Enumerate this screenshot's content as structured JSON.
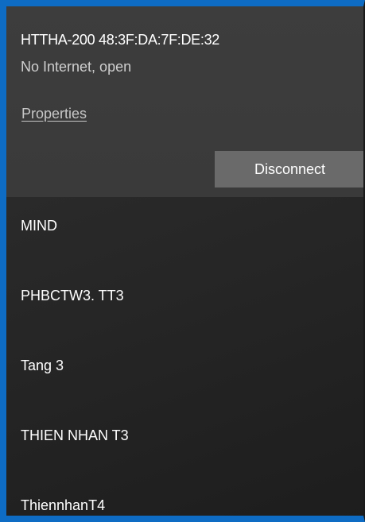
{
  "connected_network": {
    "name": "HTTHA-200 48:3F:DA:7F:DE:32",
    "status": "No Internet, open",
    "properties_label": "Properties",
    "disconnect_label": "Disconnect"
  },
  "networks": [
    {
      "name": "MIND"
    },
    {
      "name": "PHBCTW3. TT3"
    },
    {
      "name": "Tang 3"
    },
    {
      "name": "THIEN NHAN T3"
    },
    {
      "name": "ThiennhanT4"
    }
  ],
  "colors": {
    "accent_border": "#0e6cc4",
    "connected_panel": "#3b3b3b",
    "disconnect_button": "#6a6a6a",
    "list_background": "#232323"
  }
}
